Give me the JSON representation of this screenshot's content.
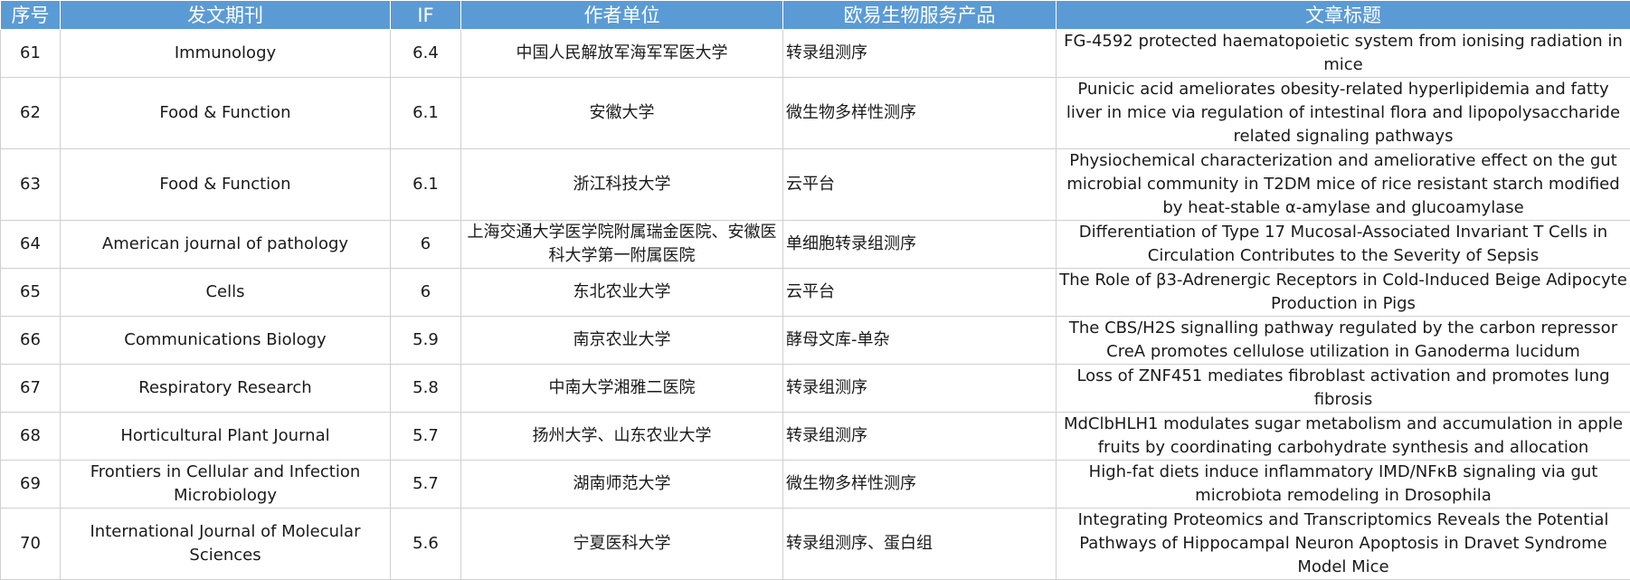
{
  "headers": [
    "序号",
    "发文期刊",
    "IF",
    "作者单位",
    "欧易生物服务产品",
    "文章标题"
  ],
  "rows": [
    {
      "no": "61",
      "journal": "Immunology",
      "if": "6.4",
      "unit": "中国人民解放军海军军医大学",
      "product": "转录组测序",
      "title": "FG-4592 protected haematopoietic system from ionising radiation in mice"
    },
    {
      "no": "62",
      "journal": "Food & Function",
      "if": "6.1",
      "unit": "安徽大学",
      "product": "微生物多样性测序",
      "title": "Punicic acid ameliorates obesity-related hyperlipidemia and fatty liver in mice via regulation of intestinal flora and lipopolysaccharide related signaling pathways"
    },
    {
      "no": "63",
      "journal": "Food & Function",
      "if": "6.1",
      "unit": "浙江科技大学",
      "product": "云平台",
      "title": "Physiochemical characterization and ameliorative effect on the gut microbial community in T2DM mice of rice resistant starch modified by heat-stable α-amylase and glucoamylase"
    },
    {
      "no": "64",
      "journal": "American journal of pathology",
      "if": "6",
      "unit": "上海交通大学医学院附属瑞金医院、安徽医科大学第一附属医院",
      "product": "单细胞转录组测序",
      "title": "Differentiation of Type 17 Mucosal-Associated Invariant T Cells in Circulation Contributes to the Severity of Sepsis"
    },
    {
      "no": "65",
      "journal": "Cells",
      "if": "6",
      "unit": "东北农业大学",
      "product": "云平台",
      "title": "The Role of β3-Adrenergic Receptors in Cold-Induced Beige Adipocyte Production in Pigs"
    },
    {
      "no": "66",
      "journal": "Communications Biology",
      "if": "5.9",
      "unit": "南京农业大学",
      "product": "酵母文库-单杂",
      "title": "The CBS/H2S signalling pathway regulated by the carbon repressor CreA promotes cellulose utilization in Ganoderma lucidum"
    },
    {
      "no": "67",
      "journal": "Respiratory Research",
      "if": "5.8",
      "unit": "中南大学湘雅二医院",
      "product": "转录组测序",
      "title": "Loss of ZNF451 mediates fibroblast activation and promotes lung fibrosis"
    },
    {
      "no": "68",
      "journal": "Horticultural Plant Journal",
      "if": "5.7",
      "unit": "扬州大学、山东农业大学",
      "product": "转录组测序",
      "title": "MdClbHLH1 modulates sugar metabolism and accumulation in apple fruits by coordinating carbohydrate synthesis and allocation"
    },
    {
      "no": "69",
      "journal": "Frontiers in Cellular and Infection Microbiology",
      "if": "5.7",
      "unit": "湖南师范大学",
      "product": "微生物多样性测序",
      "title": "High-fat diets induce inflammatory IMD/NFκB signaling via gut microbiota remodeling in Drosophila"
    },
    {
      "no": "70",
      "journal": "International Journal of Molecular Sciences",
      "if": "5.6",
      "unit": "宁夏医科大学",
      "product": "转录组测序、蛋白组",
      "title": "Integrating Proteomics and Transcriptomics Reveals the Potential Pathways of Hippocampal Neuron Apoptosis in Dravet Syndrome Model Mice"
    }
  ]
}
